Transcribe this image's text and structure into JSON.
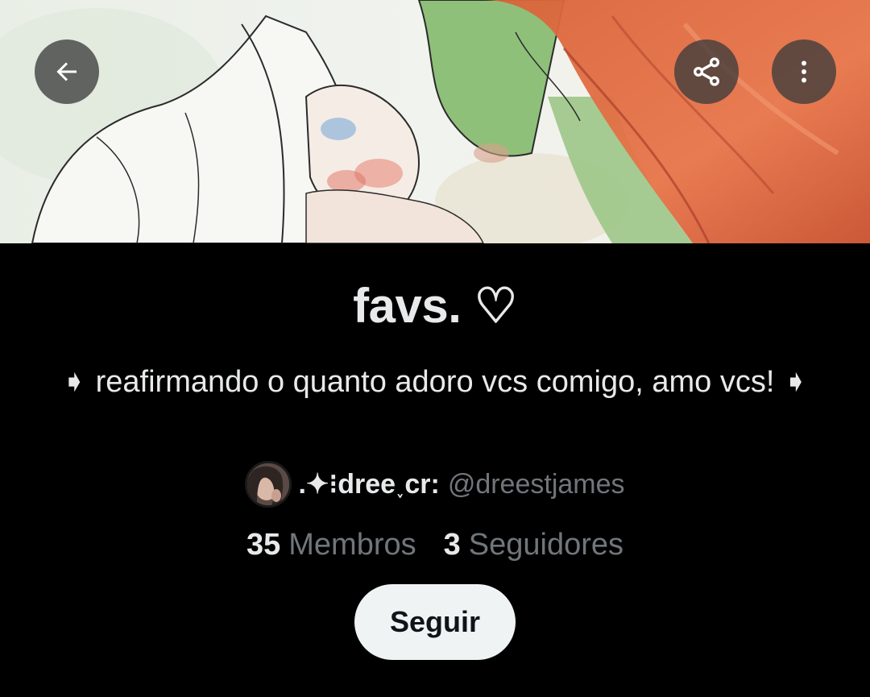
{
  "header": {
    "back_icon": "arrow-left-icon",
    "share_icon": "share-icon",
    "more_icon": "more-vertical-icon"
  },
  "list": {
    "title": "favs. ♡",
    "description": "➧ reafirmando o quanto adoro vcs comigo, amo vcs! ➧",
    "owner": {
      "display_name": ".✦⁝dree˯cr:",
      "handle": "@dreestjames"
    },
    "stats": {
      "members_count": "35",
      "members_label": "Membros",
      "followers_count": "3",
      "followers_label": "Seguidores"
    },
    "follow_label": "Seguir"
  },
  "colors": {
    "background": "#000000",
    "primary_text": "#e7e9ea",
    "secondary_text": "#71767b",
    "follow_button_bg": "#eff3f4",
    "follow_button_text": "#0f1419",
    "overlay_button_bg": "#3c3c3c"
  }
}
